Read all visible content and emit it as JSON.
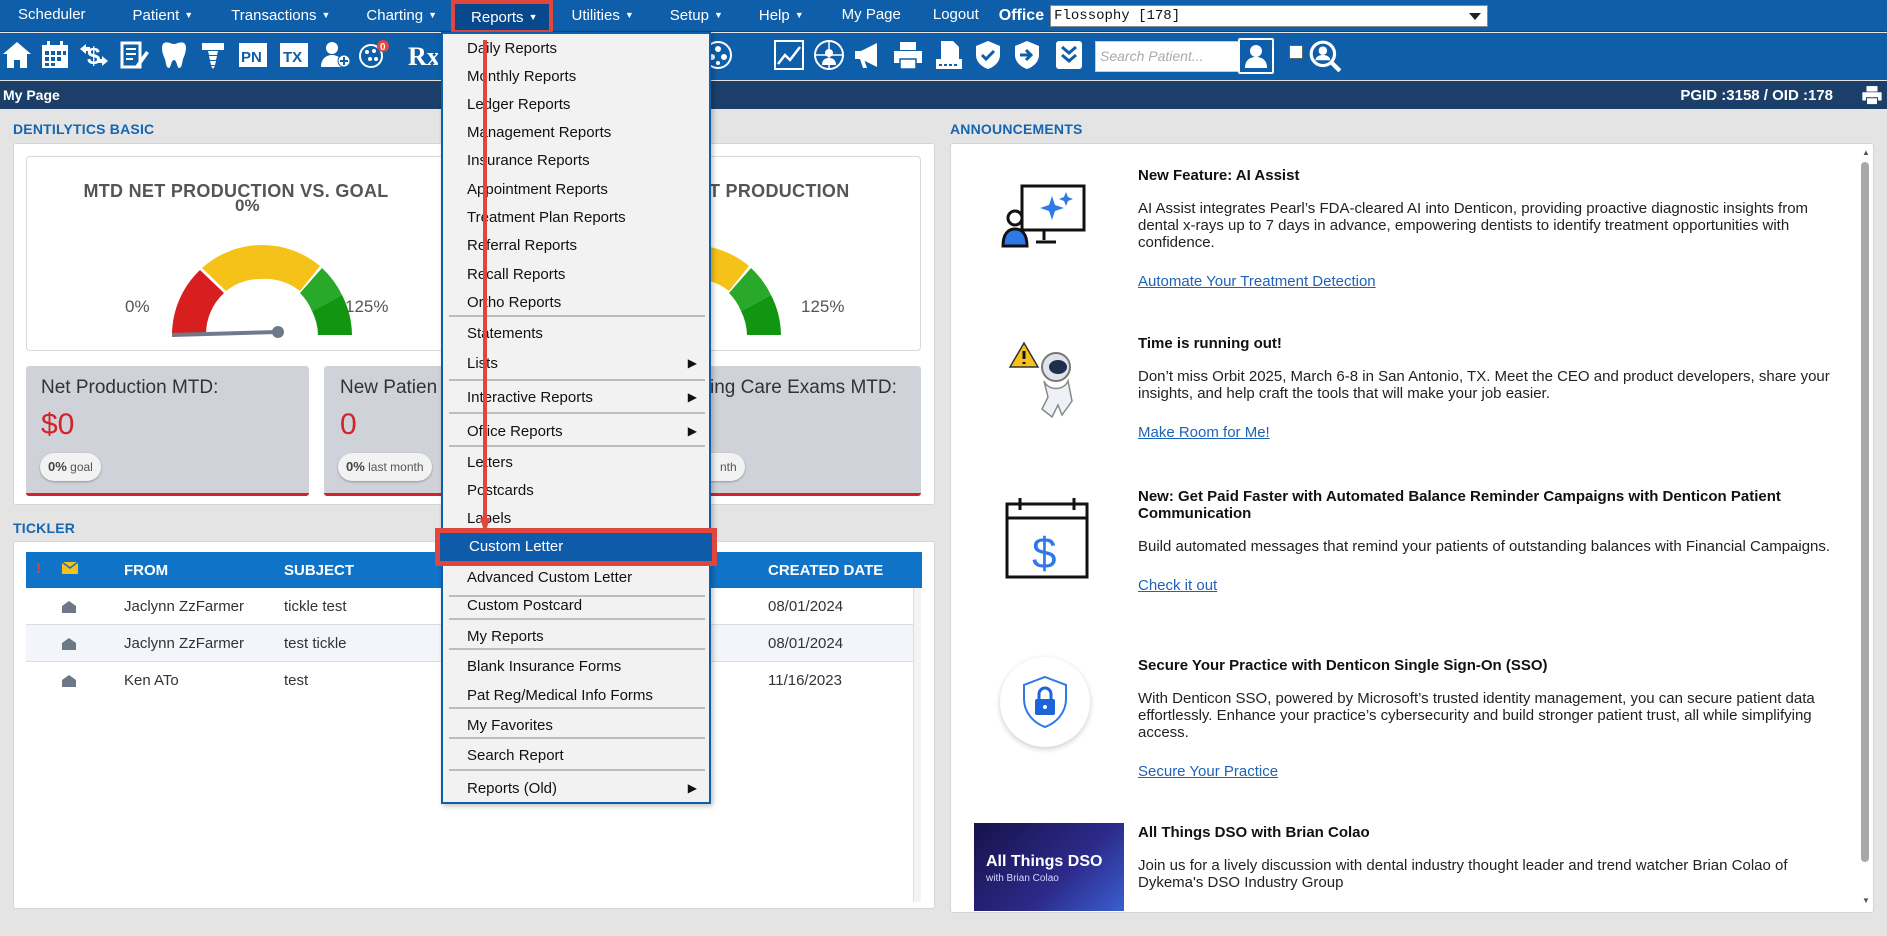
{
  "topnav": {
    "items": [
      {
        "label": "Scheduler",
        "caret": false
      },
      {
        "label": "Patient",
        "caret": true
      },
      {
        "label": "Transactions",
        "caret": true
      },
      {
        "label": "Charting",
        "caret": true
      },
      {
        "label": "Reports",
        "caret": true
      },
      {
        "label": "Utilities",
        "caret": true
      },
      {
        "label": "Setup",
        "caret": true
      },
      {
        "label": "Help",
        "caret": true
      },
      {
        "label": "My Page",
        "caret": false
      },
      {
        "label": "Logout",
        "caret": false
      }
    ],
    "office_label": "Office",
    "office_value": "Flossophy [178]"
  },
  "toolbar": {
    "search_placeholder": "Search Patient...",
    "notification_count": "0",
    "icons": [
      "home-icon",
      "calendar-icon",
      "dollar-swap-icon",
      "chart-pencil-icon",
      "tooth-icon",
      "implant-icon",
      "progress-notes-icon",
      "treatment-icon",
      "add-patient-icon",
      "notifications-icon",
      "prescription-icon"
    ]
  },
  "pagebar": {
    "title": "My Page",
    "ids": "PGID :3158  /  OID :178"
  },
  "dentilytics": {
    "heading": "DENTILYTICS BASIC",
    "gauge1": {
      "title": "MTD NET PRODUCTION VS. GOAL",
      "value_label": "0%",
      "min_label": "0%",
      "max_label": "125%",
      "value": 0
    },
    "gauge2": {
      "title_visible": "OF NET PRODUCTION",
      "max_label": "125%"
    },
    "kpis": [
      {
        "label": "Net Production MTD:",
        "value": "$0",
        "pill_pct": "0%",
        "pill_text": "goal"
      },
      {
        "label": "New Patien",
        "value": "0",
        "pill_pct": "0%",
        "pill_text": "last month"
      },
      {
        "label": "ing Care Exams MTD:",
        "value": "",
        "pill_pct": "",
        "pill_text": "nth"
      }
    ]
  },
  "tickler": {
    "heading": "TICKLER",
    "columns": {
      "flag": "!",
      "from": "FROM",
      "subject": "SUBJECT",
      "created": "CREATED DATE"
    },
    "rows": [
      {
        "from": "Jaclynn ZzFarmer",
        "subject": "tickle test",
        "created": "08/01/2024"
      },
      {
        "from": "Jaclynn ZzFarmer",
        "subject": "test tickle",
        "created": "08/01/2024"
      },
      {
        "from": "Ken ATo",
        "subject": "test",
        "created": "11/16/2023"
      }
    ]
  },
  "announcements": {
    "heading": "ANNOUNCEMENTS",
    "items": [
      {
        "title": "New Feature: AI Assist",
        "body": "AI Assist integrates Pearl’s FDA-cleared AI into Denticon, providing proactive diagnostic insights from dental x-rays up to 7 days in advance, empowering dentists to identify treatment opportunities with confidence.",
        "link": "Automate Your Treatment Detection"
      },
      {
        "title": "Time is running out!",
        "body": "Don’t miss Orbit 2025, March 6-8 in San Antonio, TX. Meet the CEO and product developers, share your insights, and help craft the tools that will make your job easier.",
        "link": "Make Room for Me!"
      },
      {
        "title": "New: Get Paid Faster with Automated Balance Reminder Campaigns with Denticon Patient Communication",
        "body": "Build automated messages that remind your patients of outstanding balances with Financial Campaigns.",
        "link": "Check it out"
      },
      {
        "title": "Secure Your Practice with Denticon Single Sign-On (SSO)",
        "body": "With Denticon SSO, powered by Microsoft’s trusted identity management, you can secure patient data effortlessly. Enhance your practice’s cybersecurity and build stronger patient trust, all while simplifying access.",
        "link": "Secure Your Practice"
      },
      {
        "title": "All Things DSO with Brian Colao",
        "body": "Join us for a lively discussion with dental industry thought leader and trend watcher Brian Colao of Dykema's DSO Industry Group",
        "link": ""
      }
    ],
    "dso_banner": {
      "line1": "All Things DSO",
      "line2": "with Brian Colao"
    }
  },
  "reports_menu": {
    "items": [
      {
        "label": "Daily Reports",
        "sub": false
      },
      {
        "label": "Monthly Reports",
        "sub": false
      },
      {
        "label": "Ledger Reports",
        "sub": false
      },
      {
        "label": "Management Reports",
        "sub": false
      },
      {
        "label": "Insurance Reports",
        "sub": false
      },
      {
        "label": "Appointment Reports",
        "sub": false
      },
      {
        "label": "Treatment Plan Reports",
        "sub": false
      },
      {
        "label": "Referral Reports",
        "sub": false
      },
      {
        "label": "Recall Reports",
        "sub": false
      },
      {
        "label": "Ortho Reports",
        "sub": false
      },
      {
        "label": "Statements",
        "sub": false
      },
      {
        "label": "Lists",
        "sub": true
      },
      {
        "label": "Interactive Reports",
        "sub": true
      },
      {
        "label": "Office Reports",
        "sub": true
      },
      {
        "label": "Letters",
        "sub": false
      },
      {
        "label": "Postcards",
        "sub": false
      },
      {
        "label": "Labels",
        "sub": false
      },
      {
        "label": "Custom Letter",
        "sub": false
      },
      {
        "label": "Advanced Custom Letter",
        "sub": false
      },
      {
        "label": "Custom Postcard",
        "sub": false
      },
      {
        "label": "My Reports",
        "sub": false
      },
      {
        "label": "Blank Insurance Forms",
        "sub": false
      },
      {
        "label": "Pat Reg/Medical Info Forms",
        "sub": false
      },
      {
        "label": "My Favorites",
        "sub": false
      },
      {
        "label": "Search Report",
        "sub": false
      },
      {
        "label": "Reports (Old)",
        "sub": true
      }
    ],
    "submenu_glyph": "▶",
    "highlighted": "Custom Letter"
  },
  "colors": {
    "nav_blue": "#0f5ea9",
    "highlight_red": "#e0463d",
    "kpi_red": "#d2232a",
    "link_blue": "#1e63b8"
  }
}
